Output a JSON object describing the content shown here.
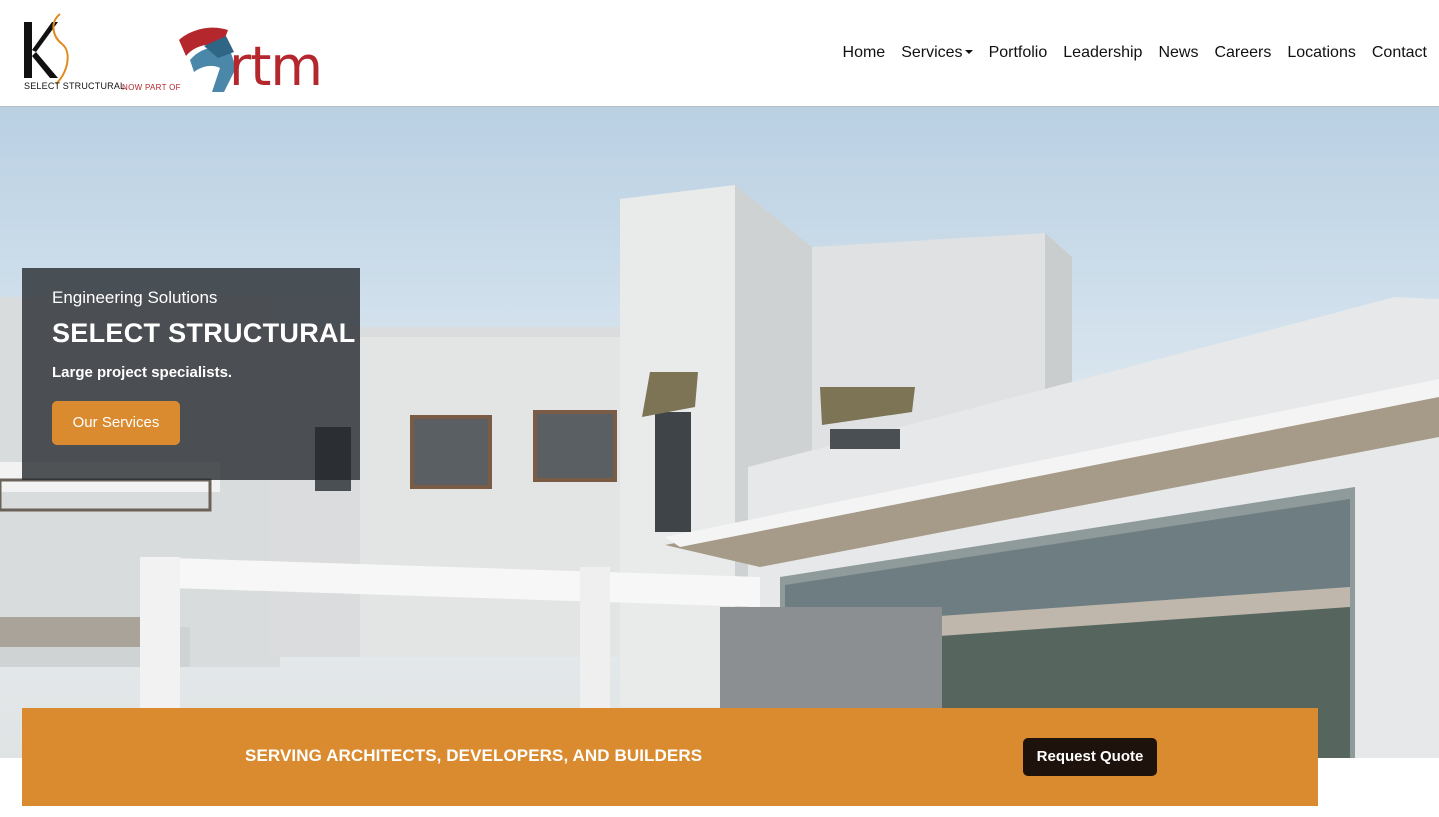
{
  "logo": {
    "brand_text": "SELECT STRUCTURAL",
    "tagline": "NOW PART OF",
    "partner": "rtm",
    "brand_colors": {
      "red": "#b4272d",
      "blue": "#4b87a8",
      "orange": "#db8b2f"
    }
  },
  "nav": {
    "items": [
      {
        "label": "Home"
      },
      {
        "label": "Services",
        "has_dropdown": true
      },
      {
        "label": "Portfolio"
      },
      {
        "label": "Leadership"
      },
      {
        "label": "News"
      },
      {
        "label": "Careers"
      },
      {
        "label": "Locations"
      },
      {
        "label": "Contact"
      }
    ]
  },
  "hero": {
    "subtitle": "Engineering Solutions",
    "title": "SELECT STRUCTURAL",
    "description": "Large project specialists.",
    "cta_label": "Our Services"
  },
  "banner": {
    "text": "SERVING ARCHITECTS, DEVELOPERS, AND BUILDERS",
    "cta_label": "Request Quote"
  },
  "colors": {
    "accent": "#db8b2f",
    "dark_button": "#1e120c",
    "caption_bg": "#23262a"
  }
}
